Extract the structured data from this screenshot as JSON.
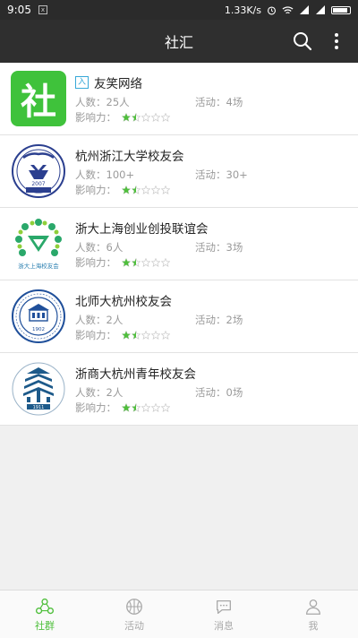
{
  "status": {
    "time": "9:05",
    "notif_icon": "x",
    "speed": "1.33K/s"
  },
  "header": {
    "title": "社汇"
  },
  "groups": [
    {
      "name": "友笑网络",
      "tag": "入",
      "members_label": "人数：",
      "members": "25人",
      "activity_label": "活动：",
      "activity": "4场",
      "influence_label": "影响力：",
      "rating": 1.5,
      "logo": "she-logo"
    },
    {
      "name": "杭州浙江大学校友会",
      "members_label": "人数：",
      "members": "100+",
      "activity_label": "活动：",
      "activity": "30+",
      "influence_label": "影响力：",
      "rating": 1.5,
      "logo": "zju-alumni-logo",
      "logo_text": "2007"
    },
    {
      "name": "浙大上海创业创投联谊会",
      "members_label": "人数：",
      "members": "6人",
      "activity_label": "活动：",
      "activity": "3场",
      "influence_label": "影响力：",
      "rating": 1.5,
      "logo": "zju-shanghai-logo",
      "logo_text": "浙大上海校友会"
    },
    {
      "name": "北师大杭州校友会",
      "members_label": "人数：",
      "members": "2人",
      "activity_label": "活动：",
      "activity": "2场",
      "influence_label": "影响力：",
      "rating": 1.5,
      "logo": "bnu-logo",
      "logo_text": "1902"
    },
    {
      "name": "浙商大杭州青年校友会",
      "members_label": "人数：",
      "members": "2人",
      "activity_label": "活动：",
      "activity": "0场",
      "influence_label": "影响力：",
      "rating": 1.5,
      "logo": "zjgsu-logo",
      "logo_text": "1911"
    }
  ],
  "tabs": [
    {
      "label": "社群",
      "icon": "community-icon",
      "active": true
    },
    {
      "label": "活动",
      "icon": "basketball-icon",
      "active": false
    },
    {
      "label": "消息",
      "icon": "chat-bubble-icon",
      "active": false
    },
    {
      "label": "我",
      "icon": "person-icon",
      "active": false
    }
  ],
  "colors": {
    "accent": "#4fbf3c",
    "tag": "#37a8d8",
    "appbar": "#2f2f2f"
  }
}
